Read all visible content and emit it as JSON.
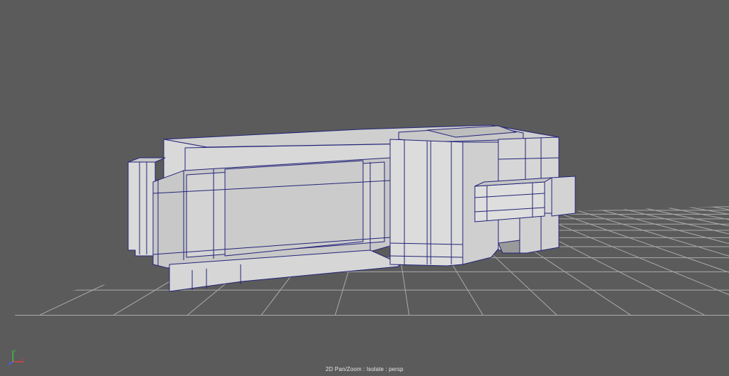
{
  "viewport": {
    "camera": "persp",
    "status_text": "2D Pan/Zoom : Isolate : persp",
    "background_color": "#5b5b5b",
    "grid_color": "#b8b8b8",
    "wire_color": "#24247a",
    "mesh_face_light": "#d6d6d6",
    "mesh_face_mid": "#c4c4c4",
    "mesh_face_dark": "#a9a9a9"
  },
  "axis_gizmo": {
    "axes": [
      "x",
      "y",
      "z"
    ],
    "x_color": "#e04040",
    "y_color": "#40c040",
    "z_color": "#4060ff",
    "icon": "axis-gizmo-icon"
  }
}
